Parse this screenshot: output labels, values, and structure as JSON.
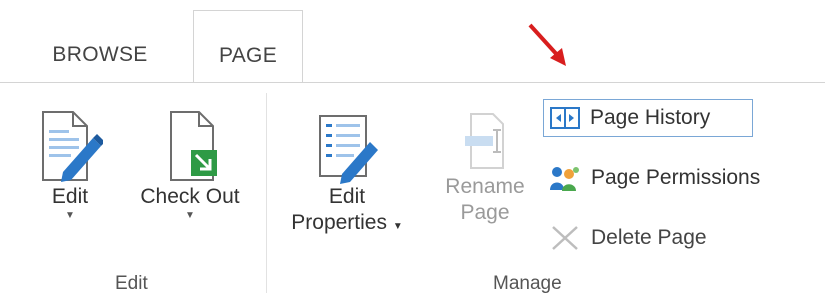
{
  "tabs": [
    {
      "label": "BROWSE",
      "selected": false
    },
    {
      "label": "PAGE",
      "selected": true
    }
  ],
  "ribbon": {
    "edit_group": {
      "label": "Edit",
      "buttons": [
        {
          "label": "Edit",
          "icon": "edit-page-icon",
          "has_dropdown": true
        },
        {
          "label": "Check Out",
          "icon": "check-out-icon",
          "has_dropdown": true
        }
      ]
    },
    "manage_group": {
      "label": "Manage",
      "edit_properties": {
        "line1": "Edit",
        "line2": "Properties",
        "icon": "edit-properties-icon",
        "has_dropdown": true
      },
      "rename_page": {
        "line1": "Rename",
        "line2": "Page",
        "icon": "rename-page-icon",
        "enabled": false
      },
      "small_buttons": [
        {
          "label": "Page History",
          "icon": "page-history-icon",
          "highlighted": true
        },
        {
          "label": "Page Permissions",
          "icon": "permissions-icon"
        },
        {
          "label": "Delete Page",
          "icon": "delete-icon",
          "enabled": false
        }
      ]
    }
  },
  "colors": {
    "accent_blue": "#2b78c8",
    "check_out_green": "#2e9a45",
    "annotation_red": "#d81e1e",
    "border": "#d4d4d4"
  }
}
